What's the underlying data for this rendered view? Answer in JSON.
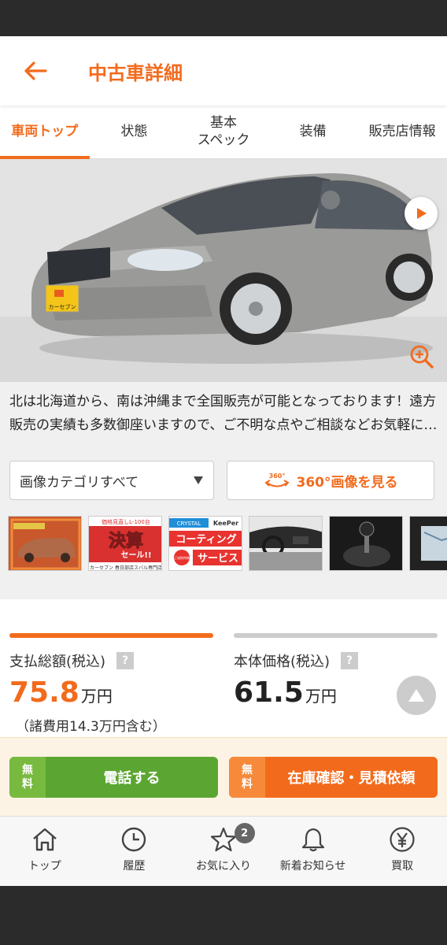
{
  "header": {
    "title": "中古車詳細"
  },
  "tabs": [
    {
      "label": "車両トップ"
    },
    {
      "label": "状態"
    },
    {
      "label": "基本\nスペック"
    },
    {
      "label": "装備"
    },
    {
      "label": "販売店情報"
    }
  ],
  "photo": {
    "plate_text": "カーセブン"
  },
  "description": "北は北海道から、南は沖縄まで全国販売が可能となっております！遠方販売の実績も多数御座いますので、ご不明な点やご相談などお気軽にお問い合わせください。",
  "controls": {
    "category_select": "画像カテゴリすべて",
    "btn360_badge": "360°",
    "btn360_label": "360°画像を見る"
  },
  "thumbnails": {
    "thumb2": {
      "top": "価格見直しL-100台",
      "main": "決算",
      "sub": "セール!!",
      "footer": "カーセブン 春日部店スバル専門店"
    },
    "thumb3": {
      "brand": "CRYSTAL",
      "brand2": "KeePer",
      "line1": "コーティング",
      "badge": "ご成約特典",
      "line2": "サービス"
    }
  },
  "prices": {
    "total": {
      "label": "支払総額(税込)",
      "value": "75.8",
      "unit": "万円",
      "note": "（諸費用14.3万円含む）"
    },
    "body": {
      "label": "本体価格(税込)",
      "value": "61.5",
      "unit": "万円"
    },
    "qmark": "?"
  },
  "cta": {
    "call": {
      "free": "無\n料",
      "label": "電話する"
    },
    "inquiry": {
      "free": "無\n料",
      "label": "在庫確認・見積依頼"
    }
  },
  "bottom_nav": {
    "items": [
      {
        "label": "トップ"
      },
      {
        "label": "履歴"
      },
      {
        "label": "お気に入り"
      },
      {
        "label": "新着お知らせ"
      },
      {
        "label": "買取"
      }
    ],
    "favorites_badge": "2"
  },
  "colors": {
    "accent": "#f26b1d",
    "green": "#5ba632",
    "gray": "#cccccc"
  }
}
